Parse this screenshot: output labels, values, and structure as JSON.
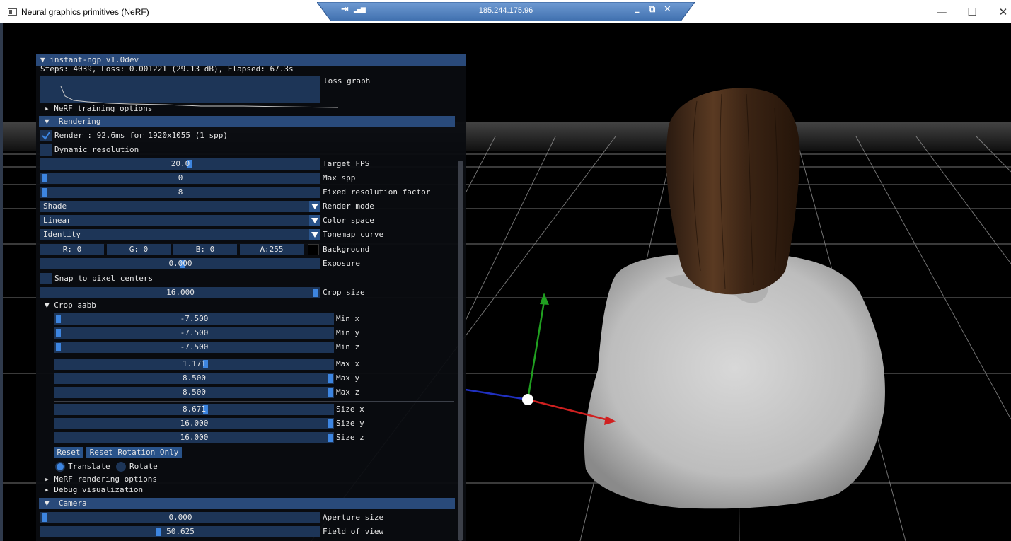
{
  "window": {
    "app_title": "Neural graphics primitives (NeRF)",
    "remote_ip": "185.244.175.96",
    "controls": {
      "minimize": "—",
      "maximize": "☐",
      "close": "✕"
    },
    "rdp_controls": {
      "pin": "⇥",
      "signal": "▂▄▆",
      "minimize": "_",
      "restore": "⧉",
      "close": "✕"
    }
  },
  "panel": {
    "title": "▼ instant-ngp v1.0dev",
    "status": "Steps: 4039, Loss: 0.001221 (29.13 dB), Elapsed: 67.3s",
    "loss_graph_label": "loss graph",
    "nerf_training_options": "▸ NeRF training options",
    "rendering_header": "▼  Rendering",
    "render_check_label": "Render : 92.6ms for 1920x1055 (1 spp)",
    "dynamic_resolution_label": "Dynamic resolution",
    "target_fps": {
      "value": "20.0",
      "label": "Target FPS"
    },
    "max_spp": {
      "value": "0",
      "label": "Max spp"
    },
    "fixed_resolution_factor": {
      "value": "8",
      "label": "Fixed resolution factor"
    },
    "render_mode": {
      "value": "Shade",
      "label": "Render mode"
    },
    "color_space": {
      "value": "Linear",
      "label": "Color space"
    },
    "tonemap_curve": {
      "value": "Identity",
      "label": "Tonemap curve"
    },
    "background": {
      "r": "R:  0",
      "g": "G:  0",
      "b": "B:  0",
      "a": "A:255",
      "label": "Background",
      "swatch": "#000000"
    },
    "exposure": {
      "value": "0.000",
      "label": "Exposure"
    },
    "snap_label": "Snap to pixel centers",
    "crop_size": {
      "value": "16.000",
      "label": "Crop size"
    },
    "crop_aabb_header": "▼ Crop aabb",
    "crop_min": [
      {
        "value": "-7.500",
        "label": "Min x"
      },
      {
        "value": "-7.500",
        "label": "Min y"
      },
      {
        "value": "-7.500",
        "label": "Min z"
      }
    ],
    "crop_max": [
      {
        "value": "1.171",
        "label": "Max x"
      },
      {
        "value": "8.500",
        "label": "Max y"
      },
      {
        "value": "8.500",
        "label": "Max z"
      }
    ],
    "crop_sizes": [
      {
        "value": "8.671",
        "label": "Size x"
      },
      {
        "value": "16.000",
        "label": "Size y"
      },
      {
        "value": "16.000",
        "label": "Size z"
      }
    ],
    "reset_label": "Reset",
    "reset_rotation_label": "Reset Rotation Only",
    "translate_label": "Translate",
    "rotate_label": "Rotate",
    "nerf_rendering_options": "▸ NeRF rendering options",
    "debug_visualization": "▸ Debug visualization",
    "camera_header": "▼  Camera",
    "aperture_size": {
      "value": "0.000",
      "label": "Aperture size"
    },
    "field_of_view": {
      "value": "50.625",
      "label": "Field of view"
    }
  },
  "colors": {
    "frame_bg": "#1d3557",
    "accent": "#3d85e0",
    "header_bg": "#294a7a",
    "gizmo_x": "#d02020",
    "gizmo_y": "#20a020",
    "gizmo_z": "#2030c0"
  }
}
